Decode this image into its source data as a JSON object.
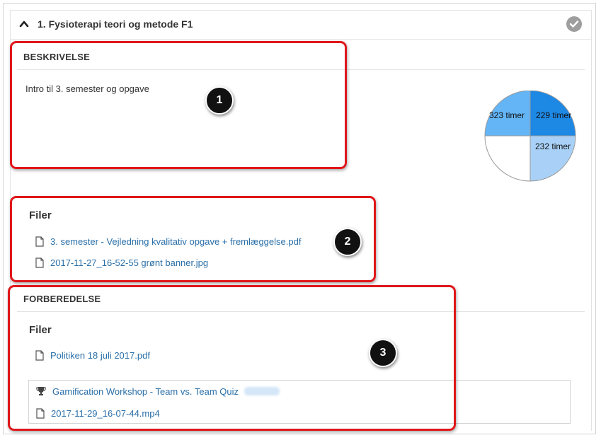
{
  "course": {
    "section_title": "1. Fysioterapi teori og metode F1",
    "icons": {
      "collapse": "chevron-up-icon",
      "completion": "check-circle-icon"
    }
  },
  "description": {
    "heading": "BESKRIVELSE",
    "text": "Intro til 3. semester og opgave"
  },
  "files1": {
    "heading": "Filer",
    "items": [
      {
        "label": "3. semester - Vejledning kvalitativ opgave + fremlæggelse.pdf",
        "icon": "file-icon"
      },
      {
        "label": "2017-11-27_16-52-55 grønt banner.jpg",
        "icon": "file-icon"
      }
    ]
  },
  "preparation": {
    "heading": "FORBEREDELSE",
    "files_heading": "Filer",
    "items": [
      {
        "label": "Politiken 18 juli 2017.pdf",
        "icon": "file-icon"
      }
    ],
    "activities": [
      {
        "label": "Gamification Workshop - Team vs. Team Quiz",
        "icon": "trophy-icon"
      },
      {
        "label": "2017-11-29_16-07-44.mp4",
        "icon": "file-icon"
      }
    ]
  },
  "hours_chart": {
    "labels": [
      "229 timer",
      "232 timer",
      "323 timer"
    ],
    "colors": {
      "dark": "#1e88e5",
      "medium": "#64b5f6",
      "light": "#a9d1f7"
    }
  },
  "callouts": [
    "1",
    "2",
    "3"
  ],
  "colors": {
    "accent_red": "#e0161a",
    "link": "#2a6fa8"
  }
}
